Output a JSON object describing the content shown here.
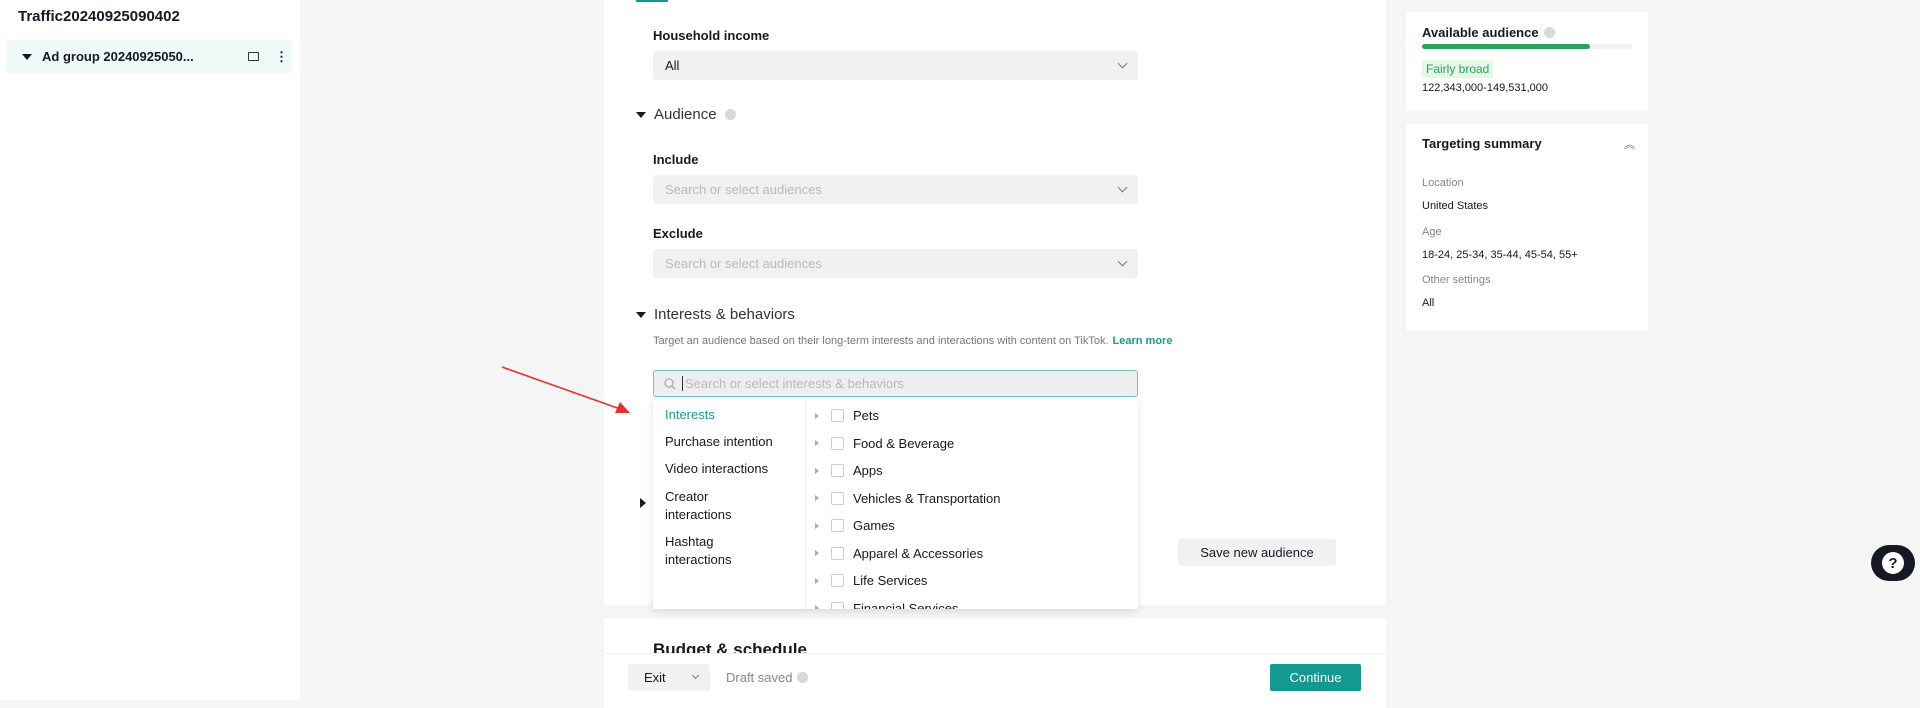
{
  "sidebar": {
    "campaign_title": "Traffic20240925090402",
    "ad_group": "Ad group 20240925050..."
  },
  "main": {
    "household_income": {
      "label": "Household income",
      "value": "All"
    },
    "audience": {
      "title": "Audience",
      "include_label": "Include",
      "include_placeholder": "Search or select audiences",
      "exclude_label": "Exclude",
      "exclude_placeholder": "Search or select audiences"
    },
    "interests": {
      "title": "Interests & behaviors",
      "description": "Target an audience based on their long-term interests and interactions with content on TikTok.",
      "learn_more": "Learn more",
      "search_placeholder": "Search or select interests & behaviors",
      "categories": [
        "Interests",
        "Purchase intention",
        "Video interactions",
        "Creator interactions",
        "Hashtag interactions"
      ],
      "active_category": "Interests",
      "options": [
        "Pets",
        "Food & Beverage",
        "Apps",
        "Vehicles & Transportation",
        "Games",
        "Apparel & Accessories",
        "Life Services",
        "Financial Services"
      ]
    },
    "save_new_audience": "Save new audience",
    "budget_title": "Budget & schedule"
  },
  "footer": {
    "exit": "Exit",
    "draft_saved": "Draft saved",
    "continue": "Continue"
  },
  "right": {
    "available": {
      "title": "Available audience",
      "level_percent": 80,
      "badge": "Fairly broad",
      "range": "122,343,000-149,531,000"
    },
    "summary": {
      "title": "Targeting summary",
      "location_label": "Location",
      "location": "United States",
      "age_label": "Age",
      "age": "18-24, 25-34, 35-44, 45-54, 55+",
      "other_label": "Other settings",
      "other": "All"
    }
  },
  "colors": {
    "accent": "#13998f",
    "bar": "#27a35a",
    "badge_bg": "#e6f7ea",
    "annotation_arrow": "#e63030"
  }
}
